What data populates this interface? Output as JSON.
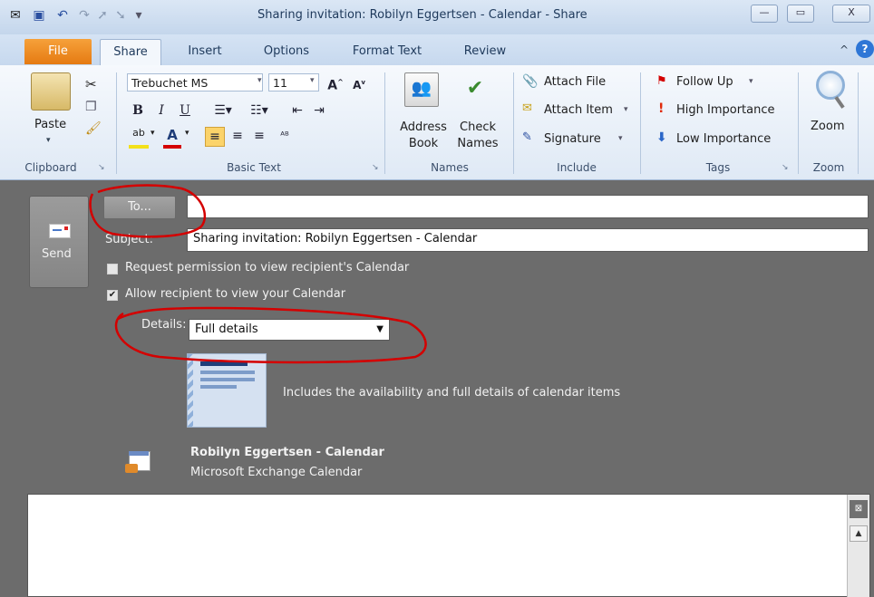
{
  "window": {
    "title": "Sharing invitation: Robilyn Eggertsen - Calendar  -  Share",
    "minimize": "—",
    "restore": "▭",
    "close": "X"
  },
  "tabs": [
    "File",
    "Share",
    "Insert",
    "Options",
    "Format Text",
    "Review"
  ],
  "ribbon": {
    "clipboard": {
      "label": "Clipboard",
      "paste": "Paste"
    },
    "basic_text": {
      "label": "Basic Text",
      "font": "Trebuchet MS",
      "size": "11"
    },
    "names": {
      "label": "Names",
      "address_book": [
        "Address",
        "Book"
      ],
      "check_names": [
        "Check",
        "Names"
      ]
    },
    "include": {
      "label": "Include",
      "attach_file": "Attach File",
      "attach_item": "Attach Item",
      "signature": "Signature"
    },
    "tags": {
      "label": "Tags",
      "follow_up": "Follow Up",
      "high_importance": "High Importance",
      "low_importance": "Low Importance"
    },
    "zoom": {
      "label": "Zoom",
      "zoom": "Zoom"
    }
  },
  "form": {
    "send": "Send",
    "to_button": "To...",
    "to_value": "",
    "subject_label": "Subject:",
    "subject_value": "Sharing invitation: Robilyn Eggertsen - Calendar",
    "request_permission": "Request permission to view recipient's Calendar",
    "request_permission_checked": false,
    "allow_view": "Allow recipient to view your Calendar",
    "allow_view_checked": true,
    "details_label": "Details:",
    "details_value": "Full details",
    "details_description": "Includes the availability and full details of calendar items",
    "calendar_name": "Robilyn Eggertsen - Calendar",
    "calendar_type": "Microsoft Exchange Calendar"
  },
  "icons": [
    "outlook-icon",
    "save-icon",
    "undo-icon",
    "redo-icon",
    "up-icon",
    "down-icon",
    "paste-icon",
    "cut-icon",
    "copy-icon",
    "format-painter-icon",
    "address-book-icon",
    "check-names-icon",
    "paperclip-icon",
    "attach-item-icon",
    "signature-icon",
    "flag-icon",
    "exclamation-icon",
    "down-arrow-icon",
    "magnifier-icon",
    "send-envelope-icon",
    "calendar-icon",
    "help-icon"
  ],
  "colors": {
    "file_tab": "#e57a12",
    "annotation": "#d40000",
    "background": "#6c6c6c"
  }
}
